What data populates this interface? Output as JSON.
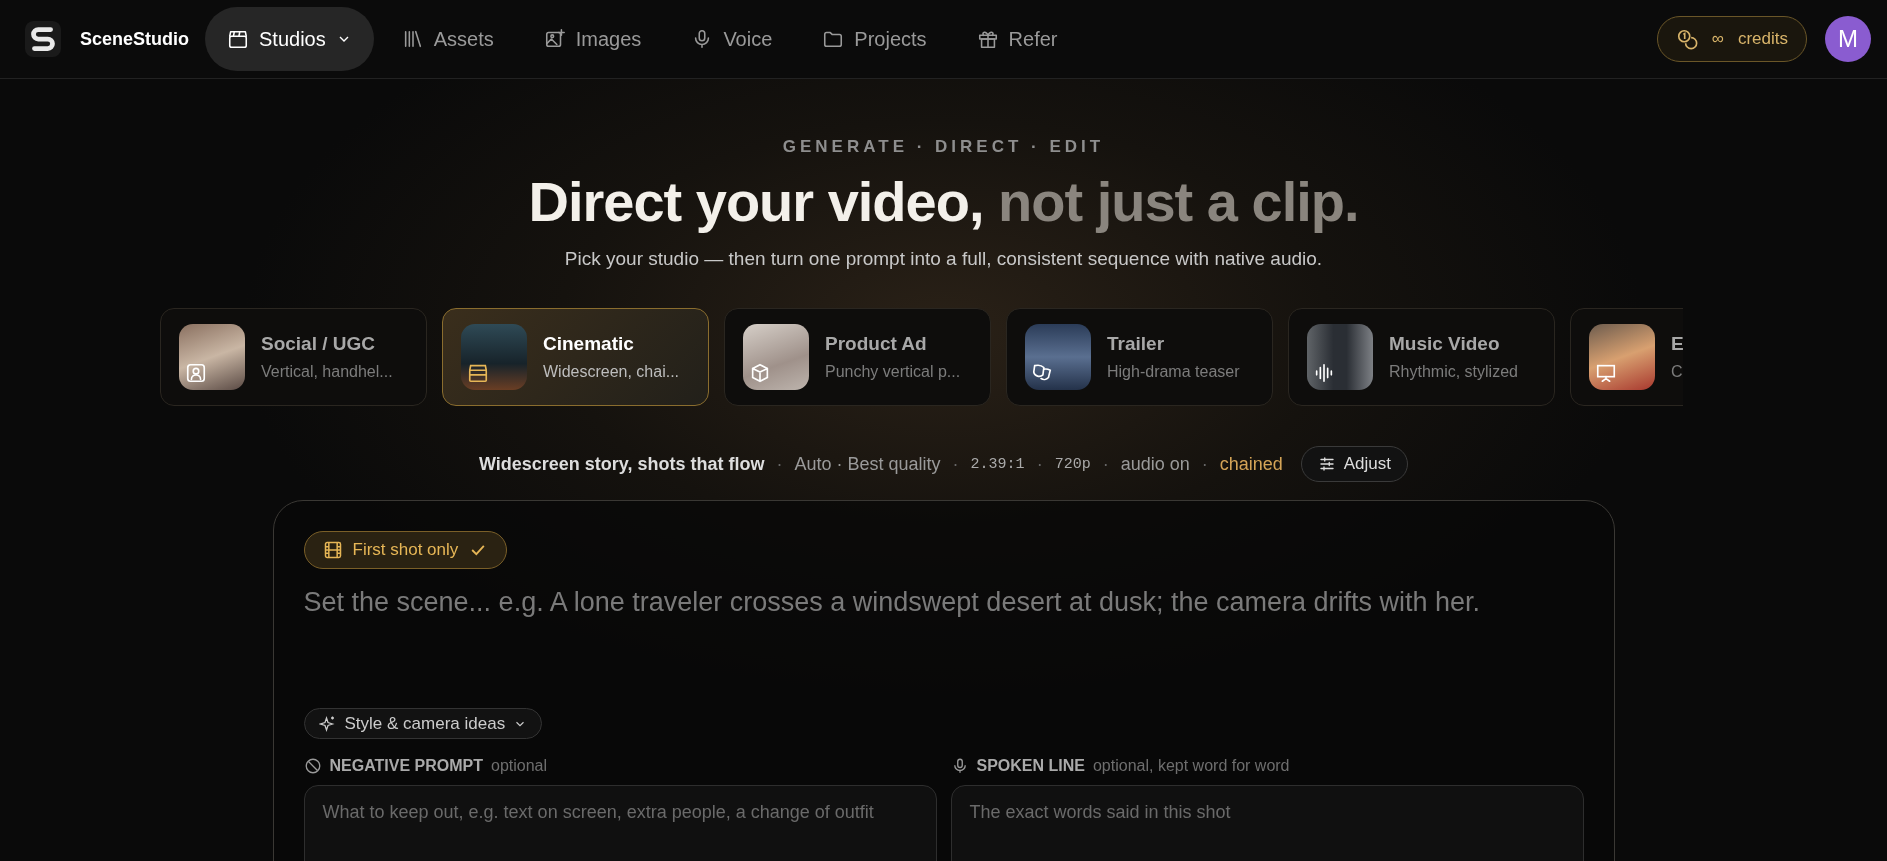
{
  "brand": {
    "name": "SceneStudio"
  },
  "nav": [
    {
      "label": "Studios",
      "selected": true,
      "dropdown": true
    },
    {
      "label": "Assets",
      "selected": false,
      "dropdown": false
    },
    {
      "label": "Images",
      "selected": false,
      "dropdown": false
    },
    {
      "label": "Voice",
      "selected": false,
      "dropdown": false
    },
    {
      "label": "Projects",
      "selected": false,
      "dropdown": false
    },
    {
      "label": "Refer",
      "selected": false,
      "dropdown": false
    }
  ],
  "credits": {
    "amount": "∞",
    "label": "credits"
  },
  "avatar": {
    "initial": "M"
  },
  "hero": {
    "eyebrow": "GENERATE · DIRECT · EDIT",
    "title": "Direct your video,",
    "title_dim": "not just a clip.",
    "subtitle": "Pick your studio — then turn one prompt into a full, consistent sequence with native audio."
  },
  "studios": [
    {
      "title": "Social / UGC",
      "subtitle": "Vertical, handhel...",
      "selected": false
    },
    {
      "title": "Cinematic",
      "subtitle": "Widescreen, chai...",
      "selected": true
    },
    {
      "title": "Product Ad",
      "subtitle": "Punchy vertical p...",
      "selected": false
    },
    {
      "title": "Trailer",
      "subtitle": "High-drama teaser",
      "selected": false
    },
    {
      "title": "Music Video",
      "subtitle": "Rhythmic, stylized",
      "selected": false
    },
    {
      "title": "E",
      "subtitle": "C",
      "selected": false
    }
  ],
  "summary": {
    "separator": "·",
    "items": [
      {
        "text": "Widescreen story, shots that flow",
        "kind": "lead"
      },
      {
        "text": "Auto · Best quality",
        "kind": "plain"
      },
      {
        "text": "2.39:1",
        "kind": "mono"
      },
      {
        "text": "720p",
        "kind": "mono"
      },
      {
        "text": "audio on",
        "kind": "plain"
      },
      {
        "text": "chained",
        "kind": "accent"
      }
    ],
    "adjust": "Adjust"
  },
  "composer": {
    "chip": {
      "label": "First shot only",
      "checked": true
    },
    "prompt_placeholder": "Set the scene... e.g. A lone traveler crosses a windswept desert at dusk; the camera drifts with her.",
    "ideas": "Style & camera ideas",
    "fields": [
      {
        "label": "NEGATIVE PROMPT",
        "hint": "optional",
        "placeholder": "What to keep out, e.g. text on screen, extra people, a change of outfit"
      },
      {
        "label": "SPOKEN LINE",
        "hint": "optional, kept word for word",
        "placeholder": "The exact words said in this shot"
      }
    ]
  }
}
